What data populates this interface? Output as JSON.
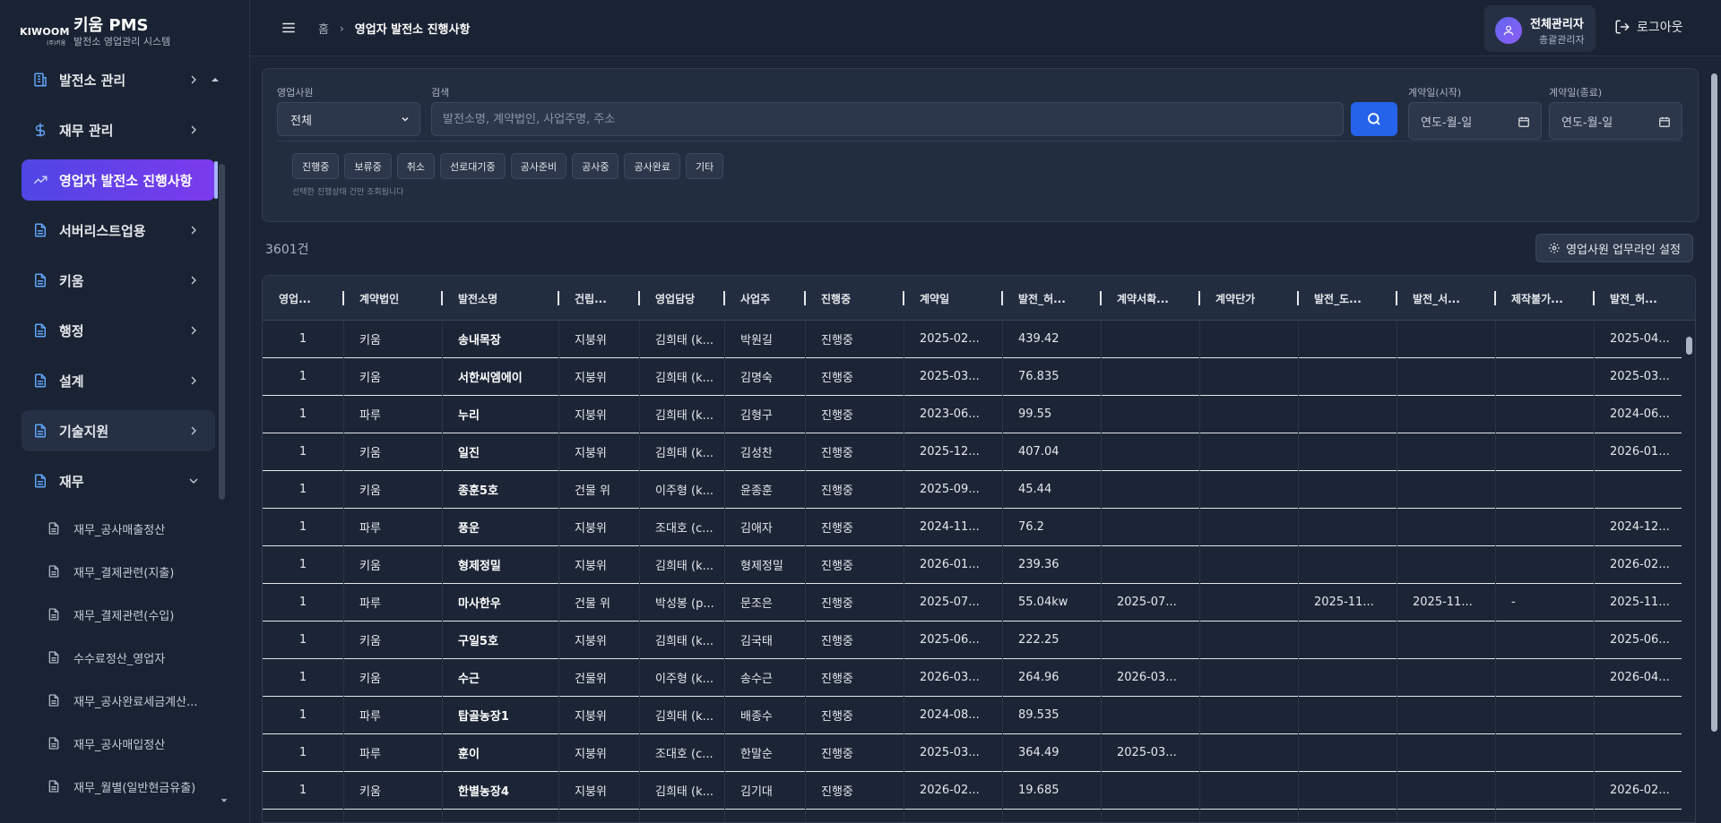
{
  "brand": {
    "logo_text": "KIWOOM",
    "logo_sub": "(주)키움",
    "title": "키움 PMS",
    "subtitle": "발전소 영업관리 시스템"
  },
  "sidebar": {
    "items": [
      {
        "label": "발전소 관리",
        "icon": "building-icon"
      },
      {
        "label": "재무 관리",
        "icon": "dollar-icon"
      },
      {
        "label": "영업자 발전소 진행사항",
        "icon": "trend-up-icon"
      },
      {
        "label": "서버리스트업용",
        "icon": "document-icon"
      },
      {
        "label": "키움",
        "icon": "document-icon"
      },
      {
        "label": "행정",
        "icon": "document-icon"
      },
      {
        "label": "설계",
        "icon": "document-icon"
      },
      {
        "label": "기술지원",
        "icon": "document-icon"
      },
      {
        "label": "재무",
        "icon": "document-icon"
      }
    ],
    "subitems": [
      {
        "label": "재무_공사매출정산"
      },
      {
        "label": "재무_결제관련(지출)"
      },
      {
        "label": "재무_결제관련(수입)"
      },
      {
        "label": "수수료정산_영업자"
      },
      {
        "label": "재무_공사완료세금계산..."
      },
      {
        "label": "재무_공사매입정산"
      },
      {
        "label": "재무_월별(일반현금유출)"
      }
    ]
  },
  "header": {
    "breadcrumb_home": "홈",
    "breadcrumb_current": "영업자 발전소 진행사항",
    "user_name": "전체관리자",
    "user_role": "총괄관리자",
    "logout_label": "로그아웃"
  },
  "filter": {
    "sales_label": "영업사원",
    "sales_value": "전체",
    "search_label": "검색",
    "search_placeholder": "발전소명, 계약법인, 사업주명, 주소",
    "start_label": "계약일(시작)",
    "end_label": "계약일(종료)",
    "date_placeholder": "연도-월-일",
    "chips": [
      "진행중",
      "보류중",
      "취소",
      "선로대기중",
      "공사준비",
      "공사중",
      "공사완료",
      "기타"
    ],
    "chip_hint": "선택한 진행상태 건만 조회됩니다"
  },
  "count_label": "3601건",
  "settings_label": "영업사원 업무라인 설정",
  "table": {
    "columns": [
      "영업...",
      "계약법인",
      "발전소명",
      "건립...",
      "영업담당",
      "사업주",
      "진행중",
      "계약일",
      "발전_허...",
      "계약서확...",
      "계약단가",
      "발전_도...",
      "발전_서...",
      "제작불가...",
      "발전_허..."
    ],
    "rows": [
      [
        "1",
        "키움",
        "송내목장",
        "지붕위",
        "김희태 (k...",
        "박원길",
        "진행중",
        "2025-02...",
        "439.42",
        "",
        "",
        "",
        "",
        "",
        "2025-04..."
      ],
      [
        "1",
        "키움",
        "서한씨엠에이",
        "지붕위",
        "김희태 (k...",
        "김명숙",
        "진행중",
        "2025-03...",
        "76.835",
        "",
        "",
        "",
        "",
        "",
        "2025-03..."
      ],
      [
        "1",
        "파루",
        "누리",
        "지붕위",
        "김희태 (k...",
        "김형구",
        "진행중",
        "2023-06...",
        "99.55",
        "",
        "",
        "",
        "",
        "",
        "2024-06..."
      ],
      [
        "1",
        "키움",
        "일진",
        "지붕위",
        "김희태 (k...",
        "김성찬",
        "진행중",
        "2025-12...",
        "407.04",
        "",
        "",
        "",
        "",
        "",
        "2026-01..."
      ],
      [
        "1",
        "키움",
        "종훈5호",
        "건물 위",
        "이주형 (k...",
        "윤종훈",
        "진행중",
        "2025-09...",
        "45.44",
        "",
        "",
        "",
        "",
        "",
        ""
      ],
      [
        "1",
        "파루",
        "풍운",
        "지붕위",
        "조대호 (c...",
        "김애자",
        "진행중",
        "2024-11...",
        "76.2",
        "",
        "",
        "",
        "",
        "",
        "2024-12..."
      ],
      [
        "1",
        "키움",
        "형제정밀",
        "지붕위",
        "김희태 (k...",
        "형제정밀",
        "진행중",
        "2026-01...",
        "239.36",
        "",
        "",
        "",
        "",
        "",
        "2026-02..."
      ],
      [
        "1",
        "파루",
        "마사한우",
        "건물 위",
        "박성봉 (p...",
        "문조은",
        "진행중",
        "2025-07...",
        "55.04kw",
        "2025-07...",
        "",
        "2025-11...",
        "2025-11...",
        "-",
        "2025-11..."
      ],
      [
        "1",
        "키움",
        "구일5호",
        "지붕위",
        "김희태 (k...",
        "김국태",
        "진행중",
        "2025-06...",
        "222.25",
        "",
        "",
        "",
        "",
        "",
        "2025-06..."
      ],
      [
        "1",
        "키움",
        "수근",
        "건물위",
        "이주형 (k...",
        "송수근",
        "진행중",
        "2026-03...",
        "264.96",
        "2026-03...",
        "",
        "",
        "",
        "",
        "2026-04..."
      ],
      [
        "1",
        "파루",
        "탑골농장1",
        "지붕위",
        "김희태 (k...",
        "배종수",
        "진행중",
        "2024-08...",
        "89.535",
        "",
        "",
        "",
        "",
        "",
        ""
      ],
      [
        "1",
        "파루",
        "훈이",
        "지붕위",
        "조대호 (c...",
        "한말순",
        "진행중",
        "2025-03...",
        "364.49",
        "2025-03...",
        "",
        "",
        "",
        "",
        ""
      ],
      [
        "1",
        "키움",
        "한별농장4",
        "지붕위",
        "김희태 (k...",
        "김기대",
        "진행중",
        "2026-02...",
        "19.685",
        "",
        "",
        "",
        "",
        "",
        "2026-02..."
      ]
    ]
  }
}
